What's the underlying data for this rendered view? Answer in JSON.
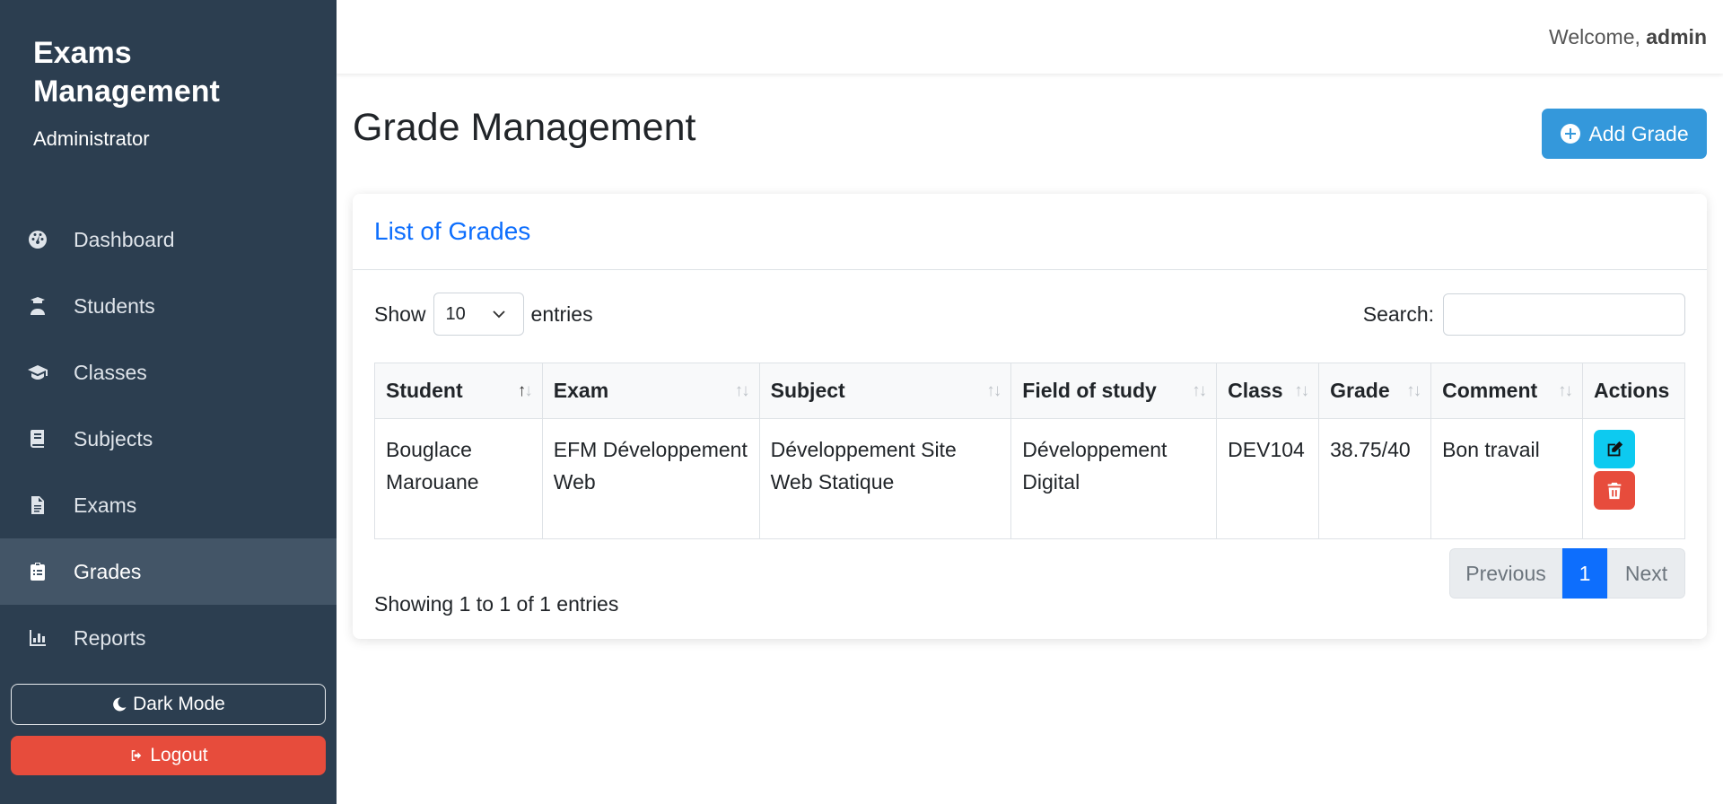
{
  "sidebar": {
    "brand_title": "Exams Management",
    "brand_sub": "Administrator",
    "items": [
      {
        "label": "Dashboard",
        "icon": "dashboard-icon"
      },
      {
        "label": "Students",
        "icon": "student-icon"
      },
      {
        "label": "Classes",
        "icon": "graduation-cap-icon"
      },
      {
        "label": "Subjects",
        "icon": "book-icon"
      },
      {
        "label": "Exams",
        "icon": "file-icon"
      },
      {
        "label": "Grades",
        "icon": "clipboard-icon",
        "active": true
      },
      {
        "label": "Reports",
        "icon": "chart-icon"
      }
    ],
    "dark_mode_label": "Dark Mode",
    "logout_label": "Logout"
  },
  "topbar": {
    "welcome_prefix": "Welcome,",
    "username": "admin"
  },
  "page": {
    "title": "Grade Management",
    "add_button": "Add Grade"
  },
  "card": {
    "title": "List of Grades",
    "show_label": "Show",
    "entries_label": "entries",
    "page_size": "10",
    "search_label": "Search:",
    "search_value": ""
  },
  "table": {
    "headers": [
      "Student",
      "Exam",
      "Subject",
      "Field of study",
      "Class",
      "Grade",
      "Comment",
      "Actions"
    ],
    "rows": [
      {
        "student": "Bouglace Marouane",
        "exam": "EFM Développement Web",
        "subject": "Développement Site Web Statique",
        "field": "Développement Digital",
        "class": "DEV104",
        "grade": "38.75/40",
        "comment": "Bon travail"
      }
    ]
  },
  "footer": {
    "info": "Showing 1 to 1 of 1 entries",
    "prev": "Previous",
    "current": "1",
    "next": "Next"
  },
  "colors": {
    "sidebar": "#2c3e50",
    "accent": "#3498db",
    "primary": "#0d6efd",
    "danger": "#e74c3c",
    "info": "#0dcaf0"
  }
}
